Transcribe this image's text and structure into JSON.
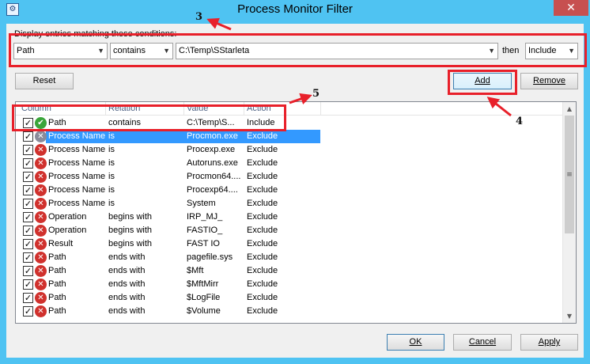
{
  "window": {
    "title": "Process Monitor Filter",
    "close_label": "✕",
    "app_icon": "procmon-icon"
  },
  "filter": {
    "heading": "Display entries matching these conditions:",
    "column_value": "Path",
    "relation_value": "contains",
    "value_value": "C:\\Temp\\SStarleta",
    "then_label": "then",
    "action_value": "Include"
  },
  "buttons": {
    "reset": "Reset",
    "add": "Add",
    "remove": "Remove",
    "ok": "OK",
    "cancel": "Cancel",
    "apply": "Apply"
  },
  "list": {
    "columns": [
      "Column",
      "Relation",
      "Value",
      "Action"
    ],
    "rows": [
      {
        "icon": "ok",
        "column": "Path",
        "relation": "contains",
        "value": "C:\\Temp\\S...",
        "action": "Include",
        "selected": false
      },
      {
        "icon": "exc",
        "column": "Process Name",
        "relation": "is",
        "value": "Procmon.exe",
        "action": "Exclude",
        "selected": true
      },
      {
        "icon": "x",
        "column": "Process Name",
        "relation": "is",
        "value": "Procexp.exe",
        "action": "Exclude",
        "selected": false
      },
      {
        "icon": "x",
        "column": "Process Name",
        "relation": "is",
        "value": "Autoruns.exe",
        "action": "Exclude",
        "selected": false
      },
      {
        "icon": "x",
        "column": "Process Name",
        "relation": "is",
        "value": "Procmon64....",
        "action": "Exclude",
        "selected": false
      },
      {
        "icon": "x",
        "column": "Process Name",
        "relation": "is",
        "value": "Procexp64....",
        "action": "Exclude",
        "selected": false
      },
      {
        "icon": "x",
        "column": "Process Name",
        "relation": "is",
        "value": "System",
        "action": "Exclude",
        "selected": false
      },
      {
        "icon": "x",
        "column": "Operation",
        "relation": "begins with",
        "value": "IRP_MJ_",
        "action": "Exclude",
        "selected": false
      },
      {
        "icon": "x",
        "column": "Operation",
        "relation": "begins with",
        "value": "FASTIO_",
        "action": "Exclude",
        "selected": false
      },
      {
        "icon": "x",
        "column": "Result",
        "relation": "begins with",
        "value": "FAST IO",
        "action": "Exclude",
        "selected": false
      },
      {
        "icon": "x",
        "column": "Path",
        "relation": "ends with",
        "value": "pagefile.sys",
        "action": "Exclude",
        "selected": false
      },
      {
        "icon": "x",
        "column": "Path",
        "relation": "ends with",
        "value": "$Mft",
        "action": "Exclude",
        "selected": false
      },
      {
        "icon": "x",
        "column": "Path",
        "relation": "ends with",
        "value": "$MftMirr",
        "action": "Exclude",
        "selected": false
      },
      {
        "icon": "x",
        "column": "Path",
        "relation": "ends with",
        "value": "$LogFile",
        "action": "Exclude",
        "selected": false
      },
      {
        "icon": "x",
        "column": "Path",
        "relation": "ends with",
        "value": "$Volume",
        "action": "Exclude",
        "selected": false
      }
    ]
  },
  "annotations": {
    "a3": "3",
    "a4": "4",
    "a5": "5"
  },
  "colors": {
    "annotation_red": "#e8202a",
    "selection": "#3399ff",
    "window_frame": "#4fc3f2"
  }
}
